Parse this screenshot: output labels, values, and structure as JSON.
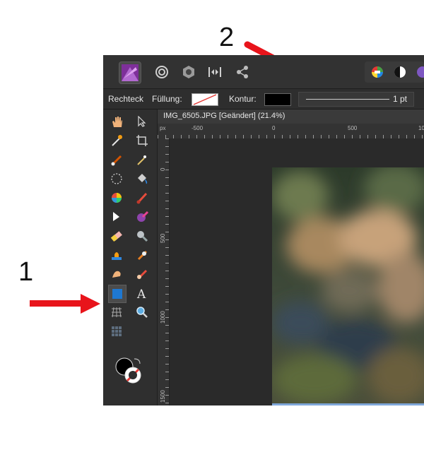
{
  "annotations": {
    "marker_1": "1",
    "marker_2": "2"
  },
  "context_toolbar": {
    "tool_name": "Rechteck",
    "fill_label": "Füllung:",
    "stroke_label": "Kontur:",
    "stroke_width": "1 pt"
  },
  "document": {
    "tab_title": "IMG_6505.JPG [Geändert] (21.4%)"
  },
  "rulers": {
    "unit": "px",
    "horizontal_labels": [
      "-500",
      "0",
      "500",
      "10"
    ],
    "vertical_labels": [
      "0",
      "500",
      "1000",
      "1500"
    ]
  },
  "colors": {
    "annotation_arrow": "#e8141b",
    "selected_tool": "#1e78d2",
    "stroke_swatch": "#000000"
  }
}
